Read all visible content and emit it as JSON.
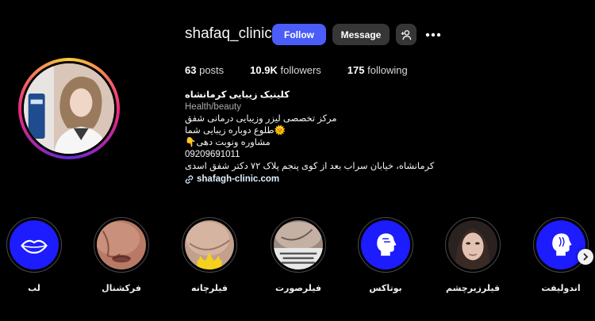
{
  "profile": {
    "username": "shafaq_clinic",
    "follow_label": "Follow",
    "message_label": "Message",
    "add_user_icon": "add-user-icon",
    "more_icon": "more-options-icon"
  },
  "stats": {
    "posts_count": "63",
    "posts_label": "posts",
    "followers_count": "10.9K",
    "followers_label": "followers",
    "following_count": "175",
    "following_label": "following"
  },
  "bio": {
    "name": "کلینیک زیبایی کرمانشاه",
    "category": "Health/beauty",
    "line1": "مرکز تخصصی لیزر وزیبایی درمانی شفق",
    "line2": "طلوع دوباره زیبایی شما🌞",
    "line3": "👇مشاوره ونوبت دهی",
    "phone": "09209691011",
    "address": "کرمانشاه، خیابان سراب بعد از کوی پنجم پلاک ۷۲ دکتر شفق اسدی",
    "link": "shafagh-clinic.com"
  },
  "highlights": [
    {
      "label": "لب"
    },
    {
      "label": "فرکشنال"
    },
    {
      "label": "فیلرچانه"
    },
    {
      "label": "فیلرصورت"
    },
    {
      "label": "بوتاکس"
    },
    {
      "label": "فیلرزیرچشم"
    },
    {
      "label": "اندولیفت"
    }
  ],
  "colors": {
    "follow_button": "#4a5df9",
    "secondary_button": "#363636",
    "highlight_blue": "#1c1cff",
    "background": "#000000"
  }
}
